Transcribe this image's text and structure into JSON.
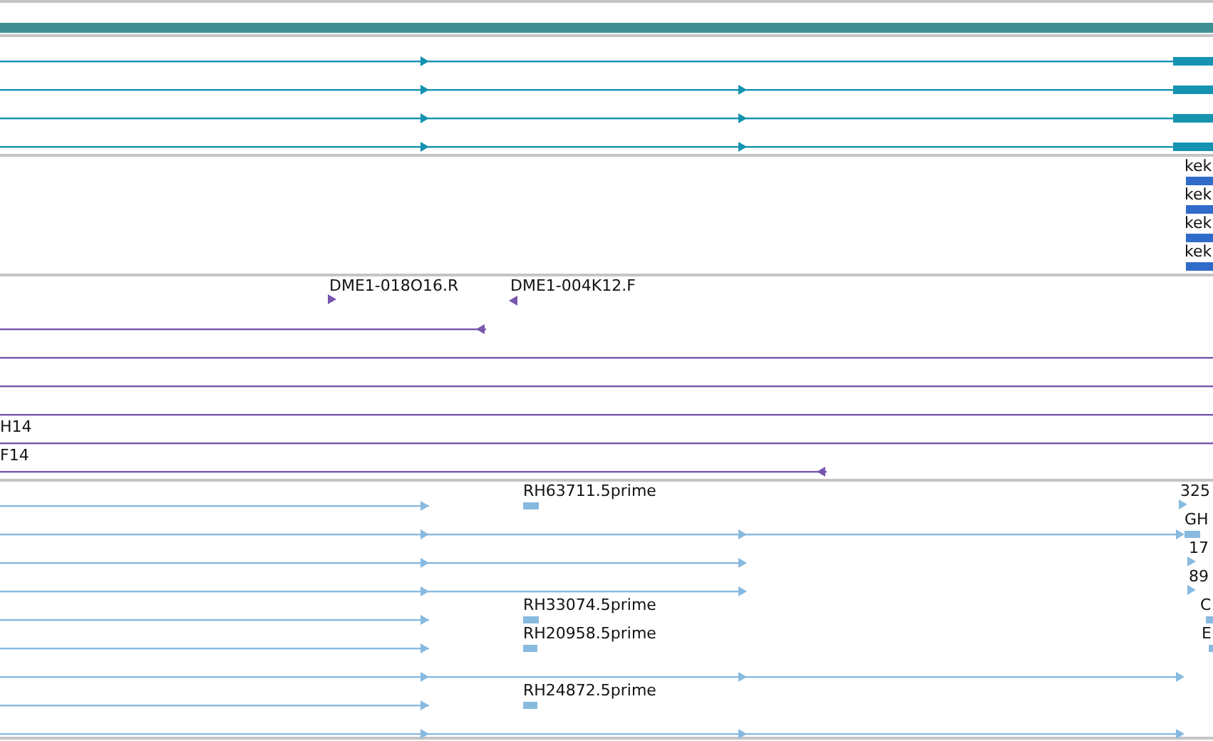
{
  "tracks": [
    {
      "color": "#1593b0",
      "features": [
        {
          "kind": "forward"
        },
        {
          "kind": "forward"
        },
        {
          "kind": "forward"
        },
        {
          "kind": "forward"
        }
      ]
    },
    {
      "color": "#316bc9",
      "features": [
        {
          "label": "kek"
        },
        {
          "label": "kek"
        },
        {
          "label": "kek"
        },
        {
          "label": "kek"
        }
      ]
    },
    {
      "color": "#7856ad",
      "features": [
        {
          "label": "DME1-018O16.R",
          "kind": "forward"
        },
        {
          "label": "DME1-004K12.F",
          "kind": "reverse"
        },
        {
          "kind": "reverse"
        },
        {
          "kind": "plain"
        },
        {
          "kind": "plain"
        },
        {
          "kind": "plain"
        },
        {
          "label": "H14"
        },
        {
          "label": "F14",
          "kind": "reverse"
        }
      ]
    },
    {
      "color": "#88bae0",
      "features": [
        {
          "kind": "forward"
        },
        {
          "label": "RH63711.5prime"
        },
        {
          "label": "325",
          "kind": "forward"
        },
        {
          "kind": "forward"
        },
        {
          "label": "GH"
        },
        {
          "kind": "forward"
        },
        {
          "label": "17",
          "kind": "forward"
        },
        {
          "kind": "forward"
        },
        {
          "label": "89",
          "kind": "forward"
        },
        {
          "kind": "forward"
        },
        {
          "label": "RH33074.5prime"
        },
        {
          "label": "C"
        },
        {
          "kind": "forward"
        },
        {
          "label": "RH20958.5prime"
        },
        {
          "label": "E"
        },
        {
          "kind": "forward"
        },
        {
          "kind": "forward"
        },
        {
          "label": "RH24872.5prime"
        },
        {
          "kind": "forward"
        }
      ]
    }
  ]
}
